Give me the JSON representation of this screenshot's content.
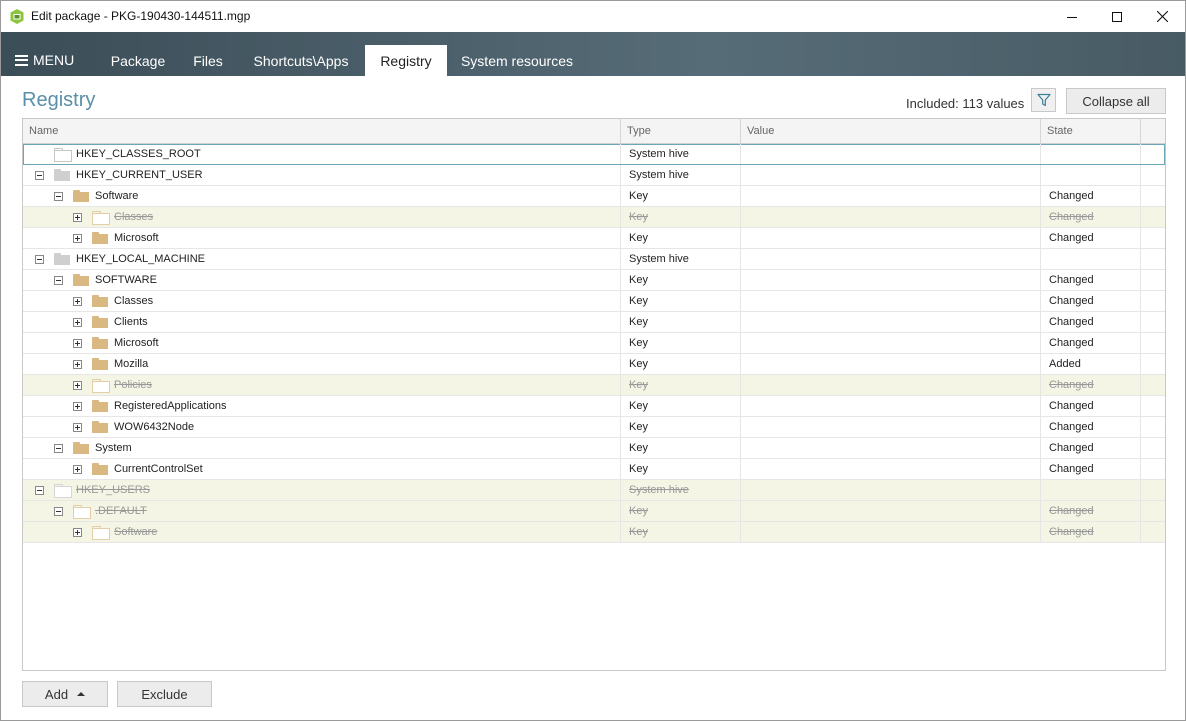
{
  "window": {
    "title": "Edit package - PKG-190430-144511.mgp"
  },
  "nav": {
    "menu_label": "MENU",
    "tabs": [
      {
        "label": "Package",
        "active": false
      },
      {
        "label": "Files",
        "active": false
      },
      {
        "label": "Shortcuts\\Apps",
        "active": false
      },
      {
        "label": "Registry",
        "active": true
      },
      {
        "label": "System resources",
        "active": false
      }
    ]
  },
  "header": {
    "title": "Registry",
    "included": "Included: 113 values",
    "collapse_label": "Collapse all"
  },
  "grid": {
    "columns": [
      "Name",
      "Type",
      "Value",
      "State"
    ],
    "rows": [
      {
        "name": "HKEY_CLASSES_ROOT",
        "level": 0,
        "toggle": "none",
        "folder": "outline",
        "type": "System hive",
        "value": "",
        "state": "",
        "excluded": false,
        "selected": true
      },
      {
        "name": "HKEY_CURRENT_USER",
        "level": 0,
        "toggle": "minus",
        "folder": "grey",
        "type": "System hive",
        "value": "",
        "state": "",
        "excluded": false,
        "selected": false
      },
      {
        "name": "Software",
        "level": 1,
        "toggle": "minus",
        "folder": "tan",
        "type": "Key",
        "value": "",
        "state": "Changed",
        "excluded": false,
        "selected": false
      },
      {
        "name": "Classes",
        "level": 2,
        "toggle": "plus",
        "folder": "hollow",
        "type": "Key",
        "value": "",
        "state": "Changed",
        "excluded": true,
        "selected": false
      },
      {
        "name": "Microsoft",
        "level": 2,
        "toggle": "plus",
        "folder": "tan",
        "type": "Key",
        "value": "",
        "state": "Changed",
        "excluded": false,
        "selected": false
      },
      {
        "name": "HKEY_LOCAL_MACHINE",
        "level": 0,
        "toggle": "minus",
        "folder": "grey",
        "type": "System hive",
        "value": "",
        "state": "",
        "excluded": false,
        "selected": false
      },
      {
        "name": "SOFTWARE",
        "level": 1,
        "toggle": "minus",
        "folder": "tan",
        "type": "Key",
        "value": "",
        "state": "Changed",
        "excluded": false,
        "selected": false
      },
      {
        "name": "Classes",
        "level": 2,
        "toggle": "plus",
        "folder": "tan",
        "type": "Key",
        "value": "",
        "state": "Changed",
        "excluded": false,
        "selected": false
      },
      {
        "name": "Clients",
        "level": 2,
        "toggle": "plus",
        "folder": "tan",
        "type": "Key",
        "value": "",
        "state": "Changed",
        "excluded": false,
        "selected": false
      },
      {
        "name": "Microsoft",
        "level": 2,
        "toggle": "plus",
        "folder": "tan",
        "type": "Key",
        "value": "",
        "state": "Changed",
        "excluded": false,
        "selected": false
      },
      {
        "name": "Mozilla",
        "level": 2,
        "toggle": "plus",
        "folder": "tan",
        "type": "Key",
        "value": "",
        "state": "Added",
        "excluded": false,
        "selected": false
      },
      {
        "name": "Policies",
        "level": 2,
        "toggle": "plus",
        "folder": "hollow",
        "type": "Key",
        "value": "",
        "state": "Changed",
        "excluded": true,
        "selected": false
      },
      {
        "name": "RegisteredApplications",
        "level": 2,
        "toggle": "plus",
        "folder": "tan",
        "type": "Key",
        "value": "",
        "state": "Changed",
        "excluded": false,
        "selected": false
      },
      {
        "name": "WOW6432Node",
        "level": 2,
        "toggle": "plus",
        "folder": "tan",
        "type": "Key",
        "value": "",
        "state": "Changed",
        "excluded": false,
        "selected": false
      },
      {
        "name": "System",
        "level": 1,
        "toggle": "minus",
        "folder": "tan",
        "type": "Key",
        "value": "",
        "state": "Changed",
        "excluded": false,
        "selected": false
      },
      {
        "name": "CurrentControlSet",
        "level": 2,
        "toggle": "plus",
        "folder": "tan",
        "type": "Key",
        "value": "",
        "state": "Changed",
        "excluded": false,
        "selected": false
      },
      {
        "name": "HKEY_USERS",
        "level": 0,
        "toggle": "minus",
        "folder": "hollow-grey",
        "type": "System hive",
        "value": "",
        "state": "",
        "excluded": true,
        "selected": false
      },
      {
        "name": ".DEFAULT",
        "level": 1,
        "toggle": "minus",
        "folder": "hollow",
        "type": "Key",
        "value": "",
        "state": "Changed",
        "excluded": true,
        "selected": false
      },
      {
        "name": "Software",
        "level": 2,
        "toggle": "plus",
        "folder": "hollow",
        "type": "Key",
        "value": "",
        "state": "Changed",
        "excluded": true,
        "selected": false
      }
    ]
  },
  "footer": {
    "add_label": "Add",
    "exclude_label": "Exclude"
  },
  "colors": {
    "accent": "#5a8fa7",
    "nav_bg": "#4b5f6a",
    "excluded_row_bg": "#f4f5e4",
    "folder": "#d9b882"
  }
}
